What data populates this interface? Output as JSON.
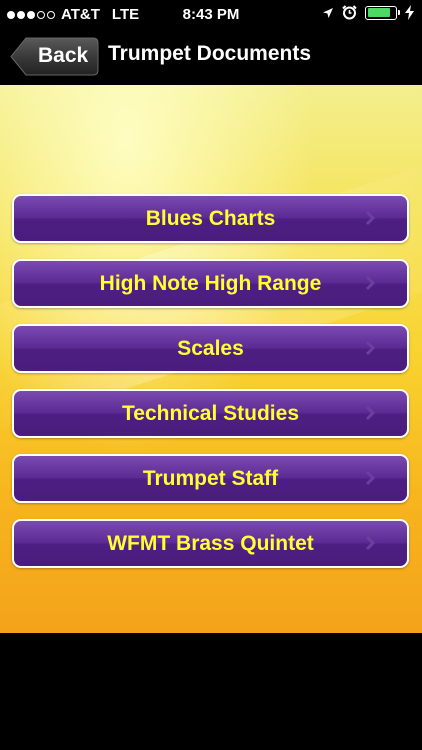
{
  "status_bar": {
    "carrier": "AT&T",
    "network": "LTE",
    "time": "8:43 PM",
    "signal_filled": 3,
    "signal_total": 5,
    "battery_level": 0.85,
    "battery_color": "#4cd964"
  },
  "navbar": {
    "back_label": "Back",
    "title": "Trumpet Documents"
  },
  "menu": {
    "items": [
      {
        "label": "Blues Charts"
      },
      {
        "label": "High Note High Range"
      },
      {
        "label": "Scales"
      },
      {
        "label": "Technical Studies"
      },
      {
        "label": "Trumpet Staff"
      },
      {
        "label": "WFMT Brass Quintet"
      }
    ],
    "label_color": "#ffff33",
    "button_color": "#5c2a94"
  },
  "icons": {
    "status": [
      "location-arrow-icon",
      "alarm-clock-icon",
      "battery-icon",
      "charging-bolt-icon"
    ],
    "nav": [
      "back-chevron-icon"
    ],
    "item": "chevron-right-icon"
  }
}
